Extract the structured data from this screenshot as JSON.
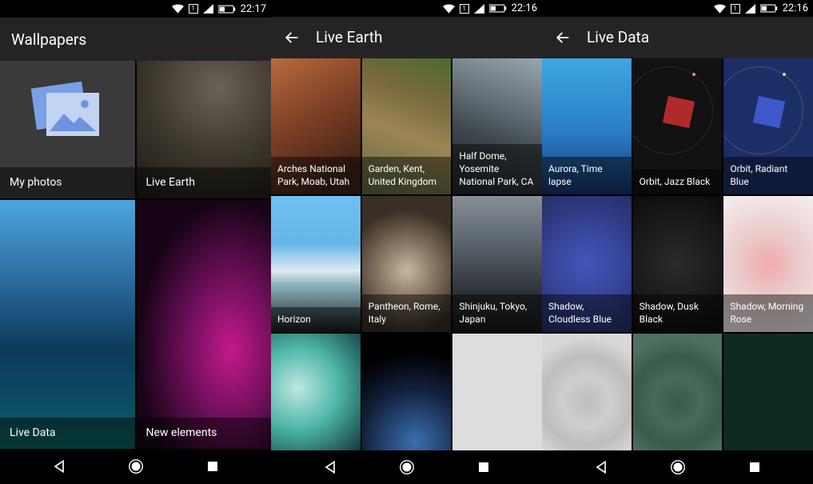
{
  "screens": [
    {
      "status": {
        "time": "22:17",
        "sim": "1"
      },
      "title": "Wallpapers",
      "has_back": false,
      "tiles": [
        {
          "label": "My photos"
        },
        {
          "label": "Live Earth"
        },
        {
          "label": "Live Data"
        },
        {
          "label": "New elements"
        }
      ]
    },
    {
      "status": {
        "time": "22:16",
        "sim": "1"
      },
      "title": "Live Earth",
      "has_back": true,
      "tiles": [
        {
          "label": "Arches National Park, Moab, Utah"
        },
        {
          "label": "Garden, Kent, United Kingdom"
        },
        {
          "label": "Half Dome, Yosemite National Park, CA"
        },
        {
          "label": "Horizon"
        },
        {
          "label": "Pantheon, Rome, Italy"
        },
        {
          "label": "Shinjuku, Tokyo, Japan"
        },
        {
          "label": ""
        },
        {
          "label": ""
        },
        {
          "label": ""
        }
      ]
    },
    {
      "status": {
        "time": "22:16",
        "sim": "1"
      },
      "title": "Live Data",
      "has_back": true,
      "tiles": [
        {
          "label": "Aurora, Time lapse"
        },
        {
          "label": "Orbit, Jazz Black"
        },
        {
          "label": "Orbit, Radiant Blue"
        },
        {
          "label": "Shadow, Cloudless Blue"
        },
        {
          "label": "Shadow, Dusk Black"
        },
        {
          "label": "Shadow, Morning Rose"
        },
        {
          "label": ""
        },
        {
          "label": ""
        },
        {
          "label": ""
        }
      ]
    }
  ]
}
